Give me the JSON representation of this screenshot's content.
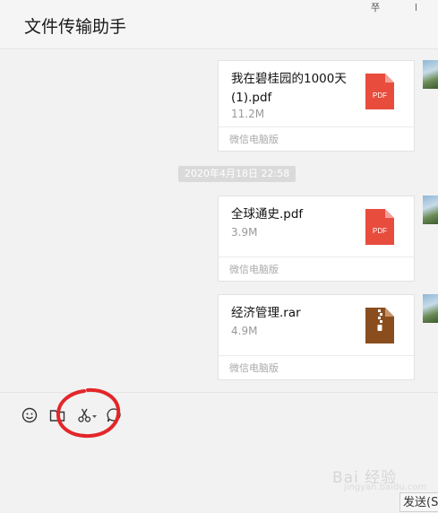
{
  "header": {
    "title": "文件传输助手",
    "pin_glyph": "쭈"
  },
  "timestamp": "2020年4月18日 22:58",
  "files": [
    {
      "name": "我在碧桂园的1000天(1).pdf",
      "size": "11.2M",
      "source": "微信电脑版",
      "type": "pdf",
      "type_label": "PDF",
      "icon_color": "#e84c3d"
    },
    {
      "name": "全球通史.pdf",
      "size": "3.9M",
      "source": "微信电脑版",
      "type": "pdf",
      "type_label": "PDF",
      "icon_color": "#e84c3d"
    },
    {
      "name": "经济管理.rar",
      "size": "4.9M",
      "source": "微信电脑版",
      "type": "rar",
      "icon_color": "#8a4e1e"
    }
  ],
  "toolbar": {
    "icons": [
      "emoji-icon",
      "folder-icon",
      "scissors-icon",
      "chat-history-icon"
    ],
    "annotation_color": "#e3262a"
  },
  "send_button": {
    "label": "发送(S"
  },
  "watermark": {
    "text": "Bai 经验",
    "sub": "jingyan.baidu.com"
  }
}
